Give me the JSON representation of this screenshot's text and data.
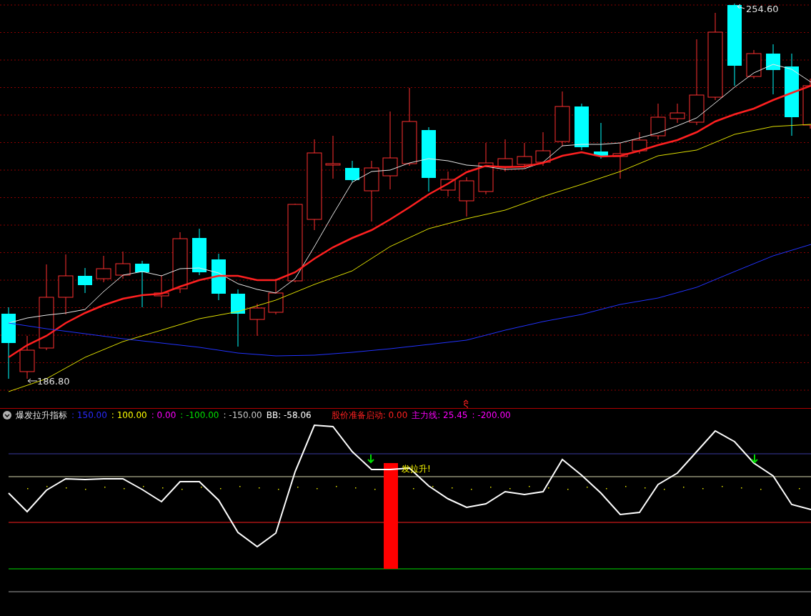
{
  "price_chart": {
    "high_label": "254.60",
    "low_label": "186.80"
  },
  "indicator": {
    "title": "爆发拉升指标",
    "collapsed": false,
    "items": [
      {
        "text": ": 150.00",
        "color": "#2a2aff"
      },
      {
        "text": ": 100.00",
        "color": "#ffff00"
      },
      {
        "text": ": 0.00",
        "color": "#ff00ff"
      },
      {
        "text": ": -100.00",
        "color": "#00e000"
      },
      {
        "text": ": -150.00",
        "color": "#c8c8c8"
      },
      {
        "text": "BB: -58.06",
        "color": "#ffffff"
      },
      {
        "text": "股价准备启动: 0.00",
        "color": "#ff2020"
      },
      {
        "text": "主力线: 25.45",
        "color": "#ff00ff"
      },
      {
        "text": ": -200.00",
        "color": "#ff00ff"
      }
    ],
    "signal_text": "发拉升!"
  }
}
